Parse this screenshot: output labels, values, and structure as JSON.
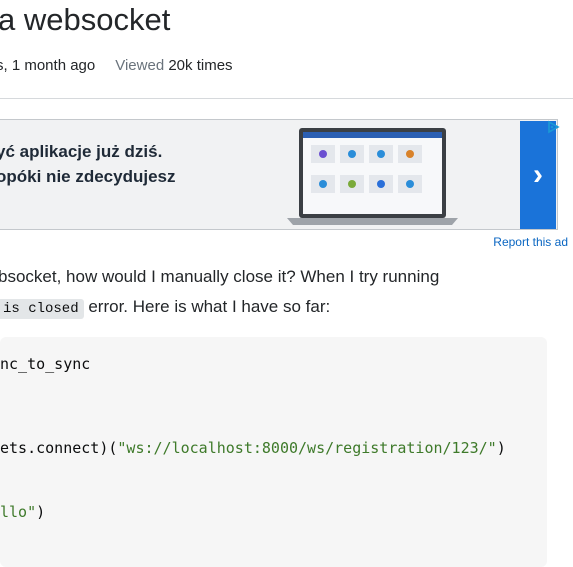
{
  "question": {
    "title": "a websocket",
    "meta": {
      "asked_value": "s, 1 month ago",
      "viewed_label": "Viewed",
      "viewed_value": "20k times"
    }
  },
  "ad": {
    "line1": "yć aplikacje już dziś.",
    "line2": "opóki nie zdecydujesz",
    "next_glyph": "›",
    "report_label": "Report this ad"
  },
  "body": {
    "line1": "bsocket, how would I manually close it? When I try running",
    "inline_code": "is closed",
    "line2_rest": " error. Here is what I have so far:"
  },
  "code": {
    "line1": "nc_to_sync",
    "line2_prefix": "ets.connect)(",
    "line2_string": "\"ws://localhost:8000/ws/registration/123/\"",
    "line2_suffix": ")",
    "line3_string": "llo\"",
    "line3_suffix": ")"
  },
  "colors": {
    "ad_button": "#1a73d9",
    "link": "#0a66c2",
    "code_string": "#3e7a2a"
  }
}
